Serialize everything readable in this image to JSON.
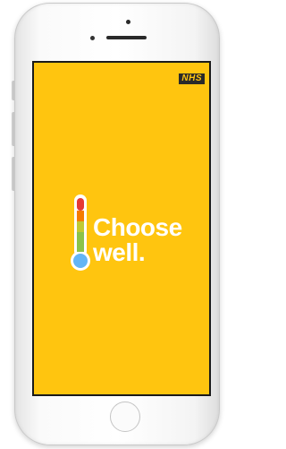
{
  "app": {
    "logo_text": "NHS",
    "headline_line1": "Choose",
    "headline_line2": "well."
  },
  "colors": {
    "background": "#ffc50f",
    "thermometer_top": "#e53935",
    "thermometer_mid": "#f57c00",
    "thermometer_low": "#8bc34a",
    "thermometer_bulb": "#64b5f6"
  }
}
